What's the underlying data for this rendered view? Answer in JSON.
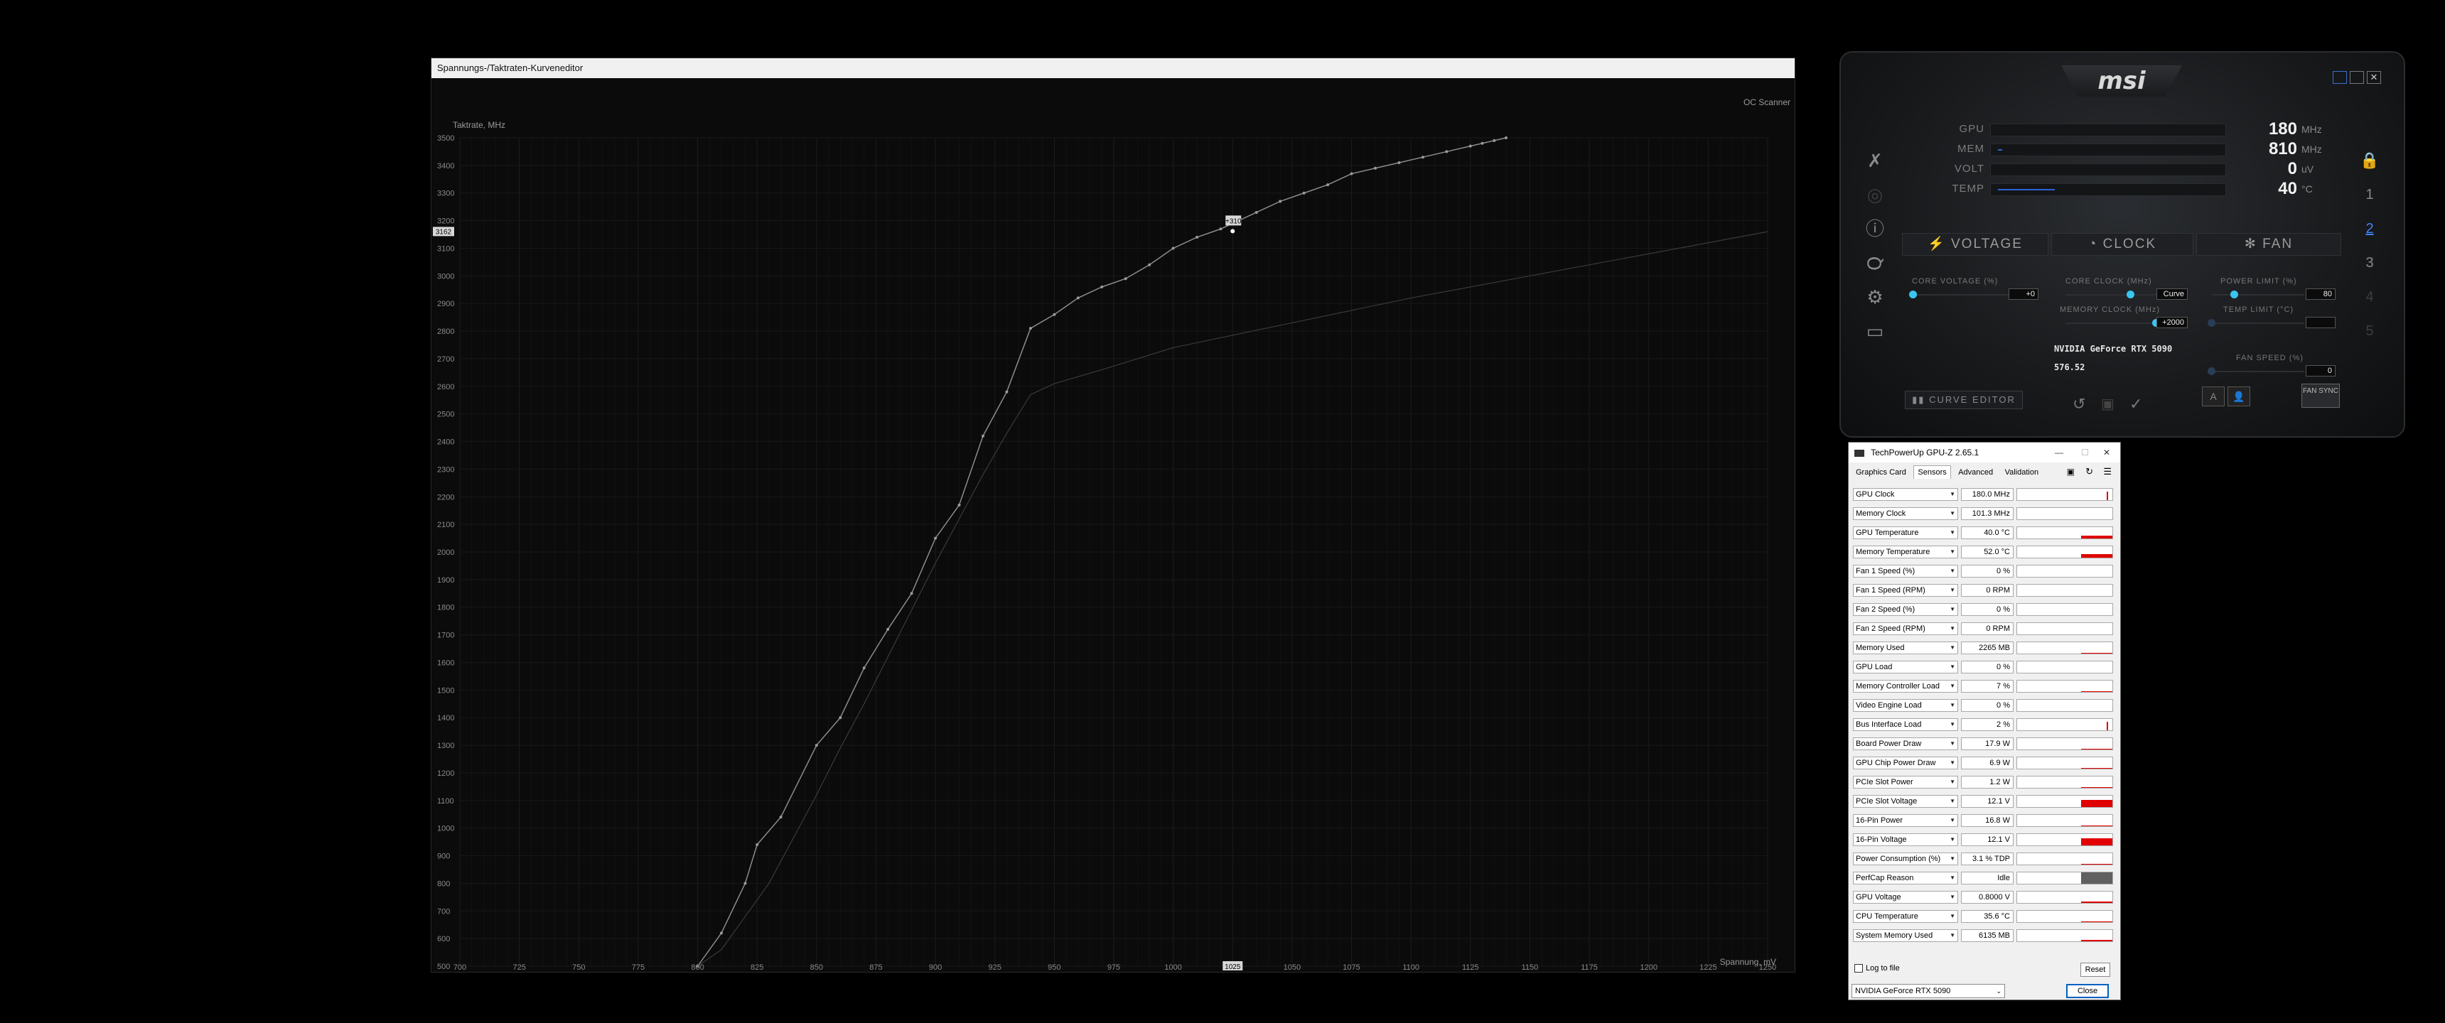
{
  "curve_editor": {
    "title": "Spannungs-/Taktraten-Kurveneditor",
    "oc_scanner": "OC Scanner",
    "ylabel": "Taktrate, MHz",
    "xlabel": "Spannung, mV",
    "marker_label": "+310",
    "current_voltage": "1025",
    "current_clock": "3162"
  },
  "chart_data": {
    "type": "line",
    "xlabel": "Spannung, mV",
    "ylabel": "Taktrate, MHz",
    "xlim": [
      700,
      1250
    ],
    "ylim": [
      500,
      3500
    ],
    "x_ticks": [
      700,
      725,
      750,
      775,
      800,
      825,
      850,
      875,
      900,
      925,
      950,
      975,
      1000,
      1025,
      1050,
      1075,
      1100,
      1125,
      1150,
      1175,
      1200,
      1225,
      1250
    ],
    "y_ticks": [
      500,
      600,
      700,
      800,
      900,
      1000,
      1100,
      1200,
      1300,
      1400,
      1500,
      1600,
      1700,
      1800,
      1900,
      2000,
      2100,
      2200,
      2300,
      2400,
      2500,
      2600,
      2700,
      2800,
      2900,
      3000,
      3100,
      3200,
      3300,
      3400,
      3500
    ],
    "series": [
      {
        "x": [
          800,
          810,
          820,
          825,
          835,
          850,
          860,
          870,
          880,
          890,
          900,
          910,
          920,
          930,
          940,
          950,
          960,
          970,
          980,
          990,
          1000,
          1010,
          1020,
          1025,
          1035,
          1045,
          1055,
          1065,
          1075,
          1085,
          1095,
          1105,
          1115,
          1125,
          1130,
          1135,
          1140
        ],
        "y": [
          500,
          620,
          800,
          940,
          1040,
          1300,
          1400,
          1580,
          1720,
          1850,
          2050,
          2170,
          2420,
          2580,
          2810,
          2860,
          2920,
          2960,
          2990,
          3040,
          3100,
          3140,
          3170,
          3190,
          3230,
          3270,
          3300,
          3330,
          3370,
          3390,
          3410,
          3430,
          3450,
          3470,
          3480,
          3490,
          3500
        ]
      },
      {
        "x": [
          800,
          810,
          820,
          830,
          840,
          850,
          860,
          870,
          880,
          890,
          900,
          910,
          920,
          930,
          940,
          950,
          970,
          1000,
          1050,
          1100,
          1150,
          1200,
          1250
        ],
        "y": [
          500,
          560,
          680,
          800,
          960,
          1120,
          1290,
          1450,
          1620,
          1790,
          1960,
          2120,
          2280,
          2430,
          2570,
          2610,
          2660,
          2740,
          2830,
          2920,
          3000,
          3080,
          3160
        ]
      }
    ]
  },
  "msi": {
    "logo": "msi",
    "monitor": [
      {
        "label": "GPU",
        "value": "180",
        "unit": "MHz",
        "fill": 0.0
      },
      {
        "label": "MEM",
        "value": "810",
        "unit": "MHz",
        "fill": 0.02
      },
      {
        "label": "VOLT",
        "value": "0",
        "unit": "uV",
        "fill": 0.0
      },
      {
        "label": "TEMP",
        "value": "40",
        "unit": "°C",
        "fill": 0.25
      }
    ],
    "panels": {
      "voltage": "VOLTAGE",
      "clock": "CLOCK",
      "fan": "FAN"
    },
    "core_voltage_label": "CORE VOLTAGE (%)",
    "core_voltage_value": "+0",
    "core_clock_label": "CORE CLOCK (MHz)",
    "core_clock_value": "Curve",
    "memory_clock_label": "MEMORY CLOCK (MHz)",
    "memory_clock_value": "+2000",
    "power_limit_label": "POWER LIMIT (%)",
    "power_limit_value": "80",
    "temp_limit_label": "TEMP LIMIT (°C)",
    "fan_speed_label": "FAN SPEED (%)",
    "fan_speed_value": "0",
    "gpu_name": "NVIDIA GeForce RTX 5090",
    "driver": "576.52",
    "curve_editor_btn": "CURVE EDITOR",
    "fan_sync_btn": "FAN SYNC",
    "profiles": [
      "1",
      "2",
      "3",
      "4",
      "5"
    ]
  },
  "gpuz": {
    "title": "TechPowerUp GPU-Z 2.65.1",
    "tabs": [
      "Graphics Card",
      "Sensors",
      "Advanced",
      "Validation"
    ],
    "sensors": [
      {
        "name": "GPU Clock",
        "value": "180.0 MHz",
        "graph": 0.05
      },
      {
        "name": "Memory Clock",
        "value": "101.3 MHz",
        "graph": 0
      },
      {
        "name": "GPU Temperature",
        "value": "40.0 °C",
        "graph": 0.25
      },
      {
        "name": "Memory Temperature",
        "value": "52.0 °C",
        "graph": 0.3
      },
      {
        "name": "Fan 1 Speed (%)",
        "value": "0 %",
        "graph": 0
      },
      {
        "name": "Fan 1 Speed (RPM)",
        "value": "0 RPM",
        "graph": 0
      },
      {
        "name": "Fan 2 Speed (%)",
        "value": "0 %",
        "graph": 0
      },
      {
        "name": "Fan 2 Speed (RPM)",
        "value": "0 RPM",
        "graph": 0
      },
      {
        "name": "Memory Used",
        "value": "2265 MB",
        "graph": 0.06
      },
      {
        "name": "GPU Load",
        "value": "0 %",
        "graph": 0
      },
      {
        "name": "Memory Controller Load",
        "value": "7 %",
        "graph": 0.06
      },
      {
        "name": "Video Engine Load",
        "value": "0 %",
        "graph": 0
      },
      {
        "name": "Bus Interface Load",
        "value": "2 %",
        "graph": 0.05
      },
      {
        "name": "Board Power Draw",
        "value": "17.9 W",
        "graph": 0.06
      },
      {
        "name": "GPU Chip Power Draw",
        "value": "6.9 W",
        "graph": 0.06
      },
      {
        "name": "PCIe Slot Power",
        "value": "1.2 W",
        "graph": 0.05
      },
      {
        "name": "PCIe Slot Voltage",
        "value": "12.1 V",
        "graph": 0.6
      },
      {
        "name": "16-Pin Power",
        "value": "16.8 W",
        "graph": 0.06
      },
      {
        "name": "16-Pin Voltage",
        "value": "12.1 V",
        "graph": 0.6
      },
      {
        "name": "Power Consumption (%)",
        "value": "3.1 % TDP",
        "graph": 0.06
      },
      {
        "name": "PerfCap Reason",
        "value": "Idle",
        "graph": 1.0
      },
      {
        "name": "GPU Voltage",
        "value": "0.8000 V",
        "graph": 0.1
      },
      {
        "name": "CPU Temperature",
        "value": "35.6 °C",
        "graph": 0.06
      },
      {
        "name": "System Memory Used",
        "value": "6135 MB",
        "graph": 0.1
      }
    ],
    "log_to_file": "Log to file",
    "reset": "Reset",
    "gpu_select": "NVIDIA GeForce RTX 5090",
    "close": "Close"
  }
}
